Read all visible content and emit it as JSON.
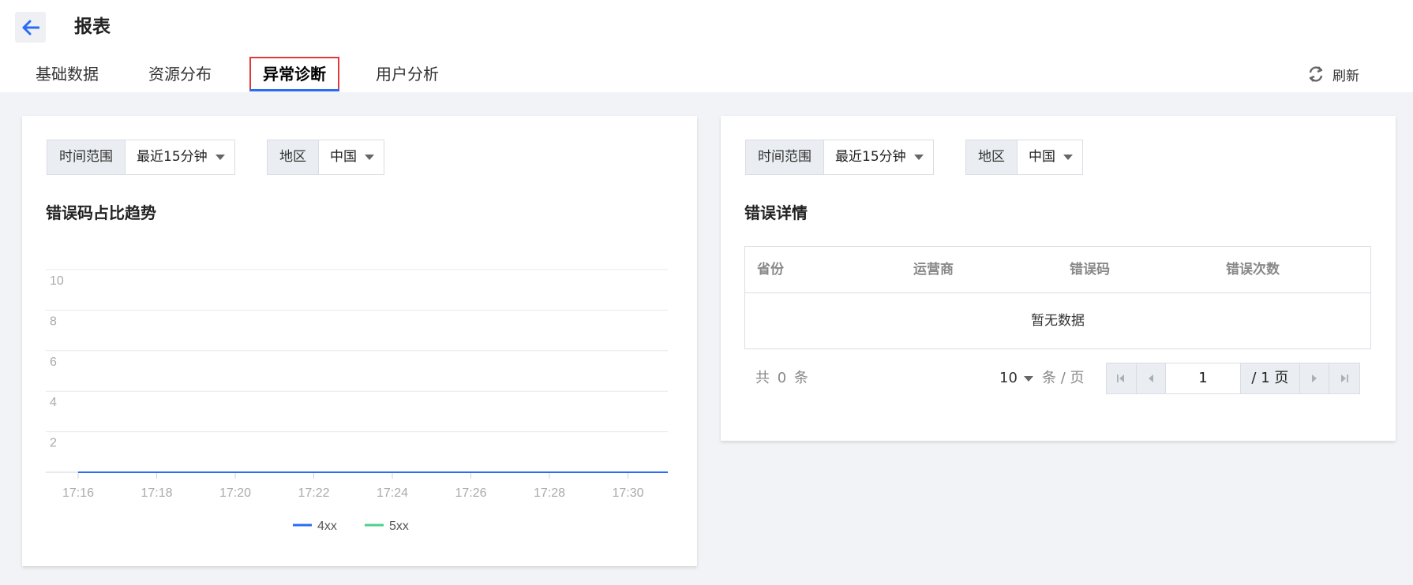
{
  "header": {
    "title": "报表",
    "back_icon": "arrow-left-icon",
    "refresh_label": "刷新",
    "refresh_icon": "refresh-icon"
  },
  "tabs": [
    {
      "label": "基础数据",
      "active": false
    },
    {
      "label": "资源分布",
      "active": false
    },
    {
      "label": "异常诊断",
      "active": true
    },
    {
      "label": "用户分析",
      "active": false
    }
  ],
  "left_panel": {
    "time_range": {
      "label": "时间范围",
      "value": "最近15分钟"
    },
    "region": {
      "label": "地区",
      "value": "中国"
    },
    "title": "错误码占比趋势"
  },
  "right_panel": {
    "time_range": {
      "label": "时间范围",
      "value": "最近15分钟"
    },
    "region": {
      "label": "地区",
      "value": "中国"
    },
    "title": "错误详情",
    "table": {
      "columns": [
        "省份",
        "运营商",
        "错误码",
        "错误次数"
      ],
      "rows": [],
      "empty_text": "暂无数据"
    },
    "pagination": {
      "total_prefix": "共",
      "total": "0",
      "total_suffix": "条",
      "page_size": "10",
      "page_size_unit": "条 / 页",
      "current_page": "1",
      "total_pages": "/ 1 页"
    }
  },
  "chart_data": {
    "type": "line",
    "x": [
      "17:16",
      "17:18",
      "17:20",
      "17:22",
      "17:24",
      "17:26",
      "17:28",
      "17:30"
    ],
    "y_ticks": [
      2,
      4,
      6,
      8,
      10
    ],
    "ylim": [
      0,
      10
    ],
    "series": [
      {
        "name": "4xx",
        "color": "#2a6cf6",
        "values": [
          0,
          0,
          0,
          0,
          0,
          0,
          0,
          0
        ]
      },
      {
        "name": "5xx",
        "color": "#4cd08a",
        "values": [
          0,
          0,
          0,
          0,
          0,
          0,
          0,
          0
        ]
      }
    ],
    "grid": true,
    "legend_position": "bottom"
  }
}
